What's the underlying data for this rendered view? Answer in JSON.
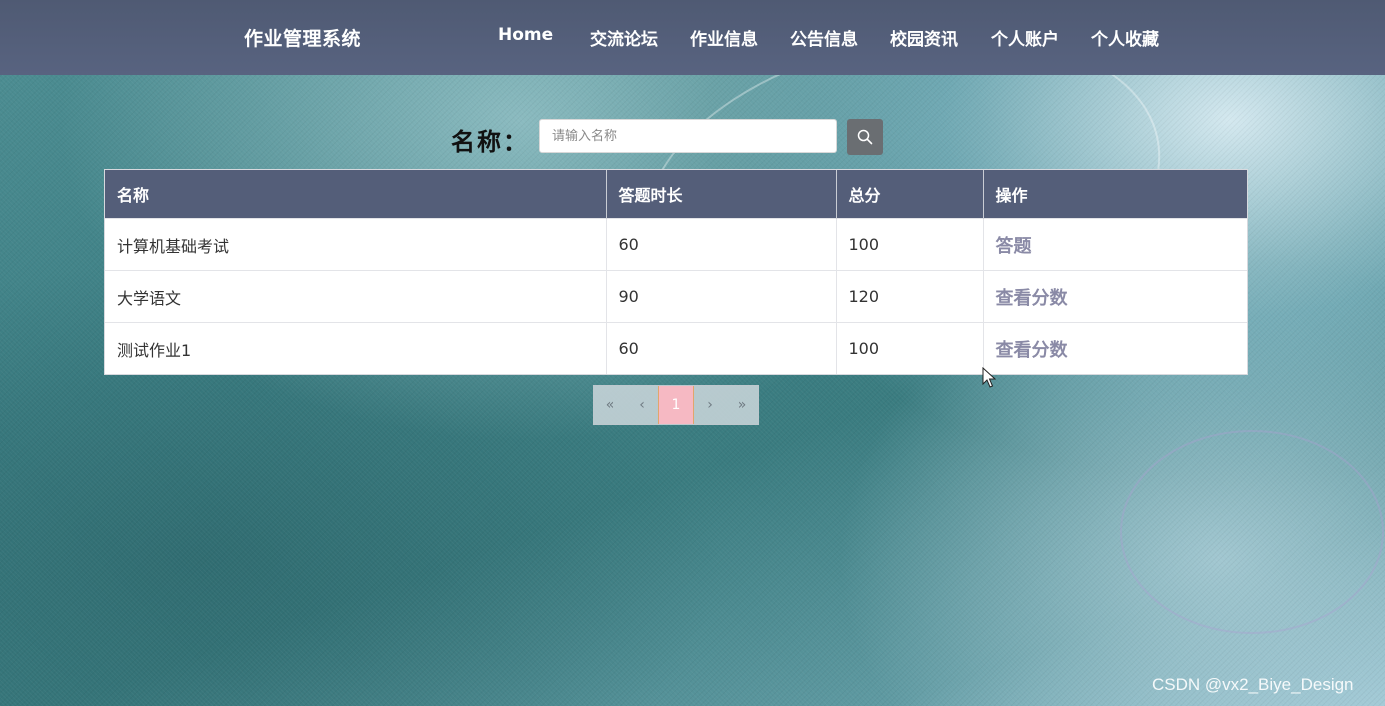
{
  "header": {
    "brand": "作业管理系统",
    "nav": [
      "Home",
      "交流论坛",
      "作业信息",
      "公告信息",
      "校园资讯",
      "个人账户",
      "个人收藏"
    ]
  },
  "search": {
    "label": "名称：",
    "placeholder": "请输入名称",
    "value": "",
    "button_icon": "search-icon"
  },
  "table": {
    "columns": [
      "名称",
      "答题时长",
      "总分",
      "操作"
    ],
    "rows": [
      {
        "name": "计算机基础考试",
        "duration": "60",
        "score": "100",
        "action": "答题"
      },
      {
        "name": "大学语文",
        "duration": "90",
        "score": "120",
        "action": "查看分数"
      },
      {
        "name": "测试作业1",
        "duration": "60",
        "score": "100",
        "action": "查看分数"
      }
    ]
  },
  "pagination": {
    "first": "«",
    "prev": "‹",
    "current": "1",
    "next": "›",
    "last": "»"
  },
  "watermark": "CSDN @vx2_Biye_Design",
  "colors": {
    "header_bg": "#545e79",
    "action_text": "#8a8aa6",
    "active_page": "#f6b9c3"
  }
}
